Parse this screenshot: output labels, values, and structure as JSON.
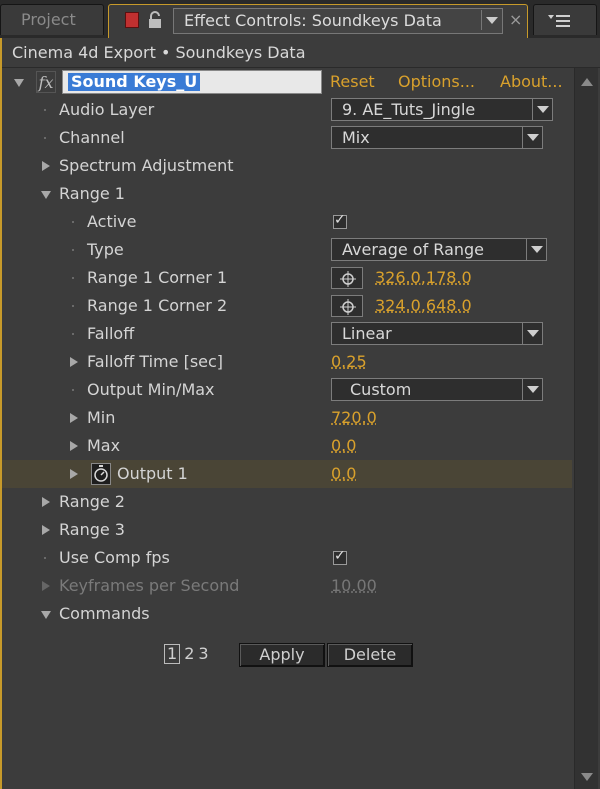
{
  "tabs": {
    "project_label": "Project",
    "active_label": "Effect Controls: Soundkeys Data",
    "close_glyph": "×"
  },
  "header": {
    "layer_path": "Cinema 4d Export • Soundkeys Data"
  },
  "effect": {
    "fx_glyph": "fx",
    "name": "Sound Keys_U",
    "reset_label": "Reset",
    "options_label": "Options...",
    "about_label": "About..."
  },
  "params": {
    "audio_layer": {
      "label": "Audio Layer",
      "value": "9. AE_Tuts_Jingle"
    },
    "channel": {
      "label": "Channel",
      "value": "Mix"
    },
    "spectrum_adjustment": {
      "label": "Spectrum Adjustment"
    },
    "range1": {
      "label": "Range 1",
      "active": {
        "label": "Active",
        "checked": true
      },
      "type": {
        "label": "Type",
        "value": "Average of Range"
      },
      "corner1": {
        "label": "Range 1 Corner 1",
        "value": "326.0,178.0"
      },
      "corner2": {
        "label": "Range 1 Corner 2",
        "value": "324.0,648.0"
      },
      "falloff": {
        "label": "Falloff",
        "value": "Linear"
      },
      "falloff_time": {
        "label": "Falloff Time [sec]",
        "value": "0.25"
      },
      "output_minmax": {
        "label": "Output Min/Max",
        "value": "Custom"
      },
      "min": {
        "label": "Min",
        "value": "720.0"
      },
      "max": {
        "label": "Max",
        "value": "0.0"
      },
      "output1": {
        "label": "Output 1",
        "value": "0.0"
      }
    },
    "range2": {
      "label": "Range 2"
    },
    "range3": {
      "label": "Range 3"
    },
    "use_comp_fps": {
      "label": "Use Comp fps",
      "checked": true
    },
    "keyframes_per_second": {
      "label": "Keyframes per Second",
      "value": "10.00"
    },
    "commands": {
      "label": "Commands",
      "tabs": [
        "1",
        "2",
        "3"
      ],
      "apply_label": "Apply",
      "delete_label": "Delete"
    }
  },
  "colors": {
    "accent": "#d9a12c",
    "panel_bg": "#3c3c3c",
    "selection": "#3a7bd5"
  }
}
